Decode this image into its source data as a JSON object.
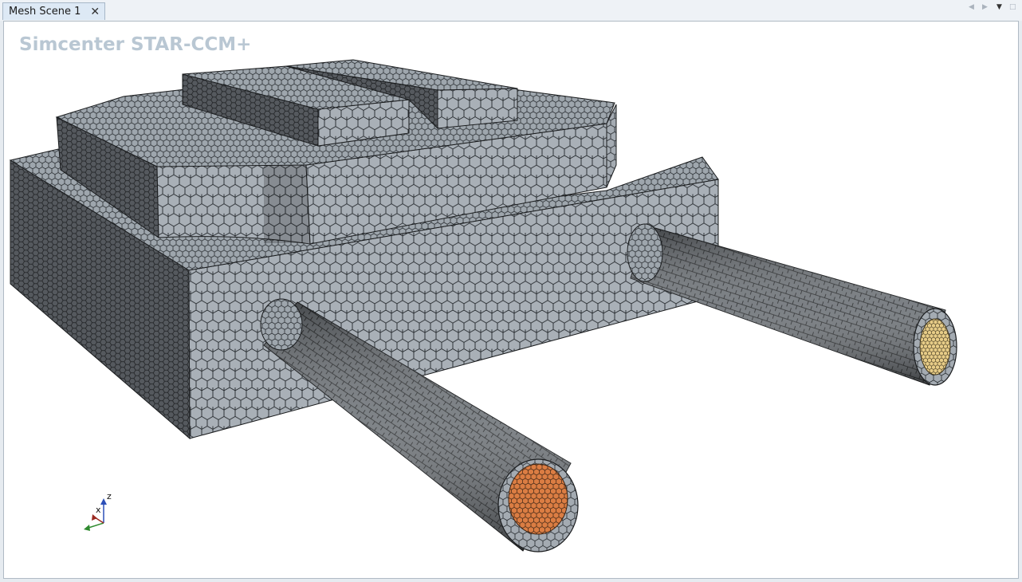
{
  "tab": {
    "label": "Mesh Scene 1",
    "close_glyph": "✕"
  },
  "tab_controls": {
    "prev": "◀",
    "next": "▶",
    "menu": "▼",
    "maximize": "□"
  },
  "viewport": {
    "watermark": "Simcenter STAR-CCM+"
  },
  "axes": {
    "x_label": "x",
    "z_label": "z"
  },
  "colors": {
    "mesh_face_light": "#a8afb6",
    "mesh_face_dark": "#454a4f",
    "mesh_edge": "#1c1f22",
    "core_orange": "#db7d43",
    "core_tan": "#e7cc87"
  }
}
